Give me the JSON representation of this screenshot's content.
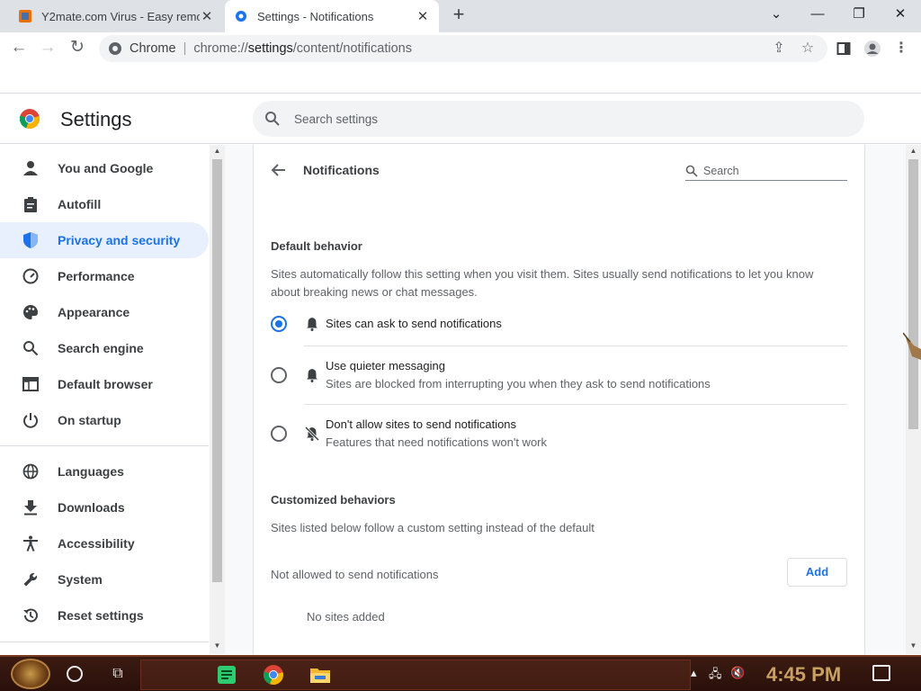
{
  "browser": {
    "tabs": [
      {
        "title": "Y2mate.com Virus - Easy remov",
        "active": false
      },
      {
        "title": "Settings - Notifications",
        "active": true
      }
    ],
    "omnibox": {
      "chip": "Chrome",
      "url_scheme": "chrome://",
      "url_host": "settings",
      "url_path": "/content/notifications"
    },
    "window_controls": {
      "minimize": "—",
      "restore": "❐",
      "close": "✕",
      "tab_search": "⌄"
    }
  },
  "settings": {
    "title": "Settings",
    "search_placeholder": "Search settings"
  },
  "sidebar": {
    "items": [
      {
        "label": "You and Google",
        "icon": "person-icon",
        "selected": false
      },
      {
        "label": "Autofill",
        "icon": "clipboard-icon",
        "selected": false
      },
      {
        "label": "Privacy and security",
        "icon": "shield-icon",
        "selected": true
      },
      {
        "label": "Performance",
        "icon": "speedometer-icon",
        "selected": false
      },
      {
        "label": "Appearance",
        "icon": "palette-icon",
        "selected": false
      },
      {
        "label": "Search engine",
        "icon": "search-icon",
        "selected": false
      },
      {
        "label": "Default browser",
        "icon": "browser-icon",
        "selected": false
      },
      {
        "label": "On startup",
        "icon": "power-icon",
        "selected": false
      },
      {
        "label": "Languages",
        "icon": "globe-icon",
        "selected": false
      },
      {
        "label": "Downloads",
        "icon": "download-icon",
        "selected": false
      },
      {
        "label": "Accessibility",
        "icon": "accessibility-icon",
        "selected": false
      },
      {
        "label": "System",
        "icon": "wrench-icon",
        "selected": false
      },
      {
        "label": "Reset settings",
        "icon": "history-icon",
        "selected": false
      }
    ]
  },
  "main": {
    "heading": "Notifications",
    "search_placeholder": "Search",
    "default_behavior": {
      "title": "Default behavior",
      "description": "Sites automatically follow this setting when you visit them. Sites usually send notifications to let you know about breaking news or chat messages.",
      "options": [
        {
          "label": "Sites can ask to send notifications",
          "sublabel": "",
          "checked": true,
          "icon": "bell-icon"
        },
        {
          "label": "Use quieter messaging",
          "sublabel": "Sites are blocked from interrupting you when they ask to send notifications",
          "checked": false,
          "icon": "bell-icon"
        },
        {
          "label": "Don't allow sites to send notifications",
          "sublabel": "Features that need notifications won't work",
          "checked": false,
          "icon": "bell-off-icon"
        }
      ]
    },
    "customized_behaviors": {
      "title": "Customized behaviors",
      "description": "Sites listed below follow a custom setting instead of the default",
      "not_allowed_label": "Not allowed to send notifications",
      "add_label": "Add",
      "empty_label": "No sites added"
    }
  },
  "taskbar": {
    "clock": "4:45 PM"
  },
  "colors": {
    "accent": "#1a73e8",
    "selected_bg": "#e8f0fe",
    "tabstrip": "#dee1e6"
  }
}
